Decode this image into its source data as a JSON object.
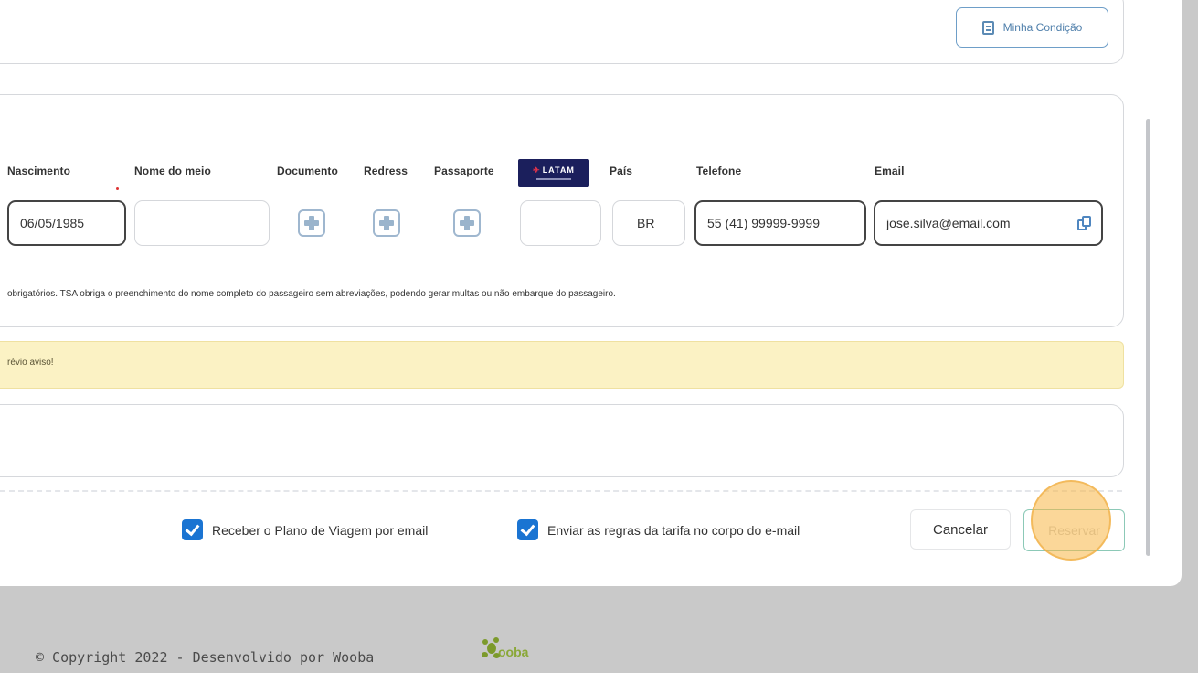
{
  "header": {
    "condition_button": "Minha Condição",
    "condition_icon": "document-icon"
  },
  "passenger": {
    "columns": {
      "birth": "Nascimento",
      "middle_name": "Nome do meio",
      "document": "Documento",
      "redress": "Redress",
      "passport": "Passaporte",
      "airline_logo": "LATAM",
      "country": "País",
      "phone": "Telefone",
      "email": "Email"
    },
    "values": {
      "birth": "06/05/1985",
      "middle_name": "",
      "loyalty": "",
      "country": "BR",
      "phone": "55 (41) 99999-9999",
      "email": "jose.silva@email.com"
    },
    "note": "obrigatórios. TSA obriga o preenchimento do nome completo do passageiro sem abreviações, podendo gerar multas ou não embarque do passageiro."
  },
  "warning": {
    "text": "révio aviso!"
  },
  "options": {
    "send_plan": {
      "label": "Receber o Plano de Viagem por email",
      "checked": true
    },
    "send_rules": {
      "label": "Enviar as regras da tarifa no corpo do e-mail",
      "checked": true
    }
  },
  "actions": {
    "cancel": "Cancelar",
    "reserve": "Reservar"
  },
  "footer": {
    "copyright": "© Copyright 2022 - Desenvolvido por Wooba",
    "logo_text": "ooba"
  },
  "colors": {
    "accent_blue": "#1a74d2",
    "warning_bg": "#fbf2c4",
    "latam_navy": "#1b1f5c",
    "highlight": "#f7b746"
  }
}
